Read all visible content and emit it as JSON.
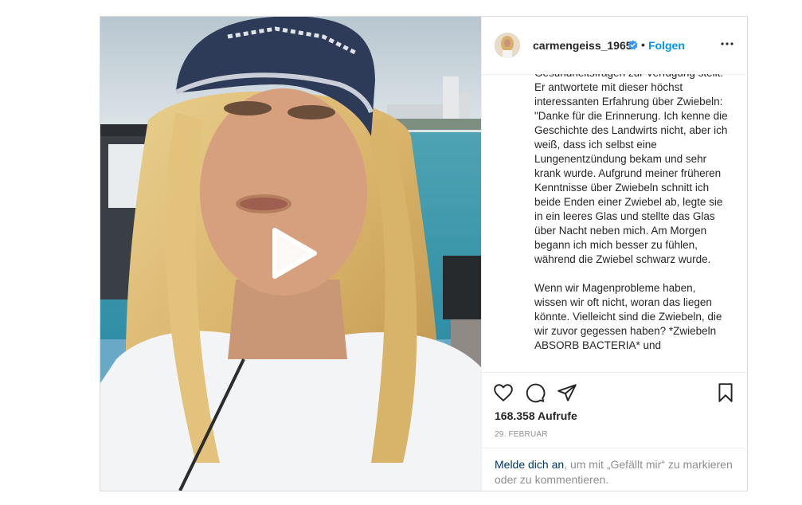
{
  "header": {
    "username": "carmengeiss_1965",
    "separator": "•",
    "follow_label": "Folgen",
    "icons": {
      "verified": "verified-badge-icon",
      "more": "more-options-icon"
    }
  },
  "media": {
    "type": "video",
    "play_icon": "play-icon"
  },
  "caption": {
    "text": "Gesundheitsfragen zur Verfügung stellt. Er antwortete mit dieser höchst interessanten Erfahrung über Zwiebeln: \"Danke für die Erinnerung. Ich kenne die Geschichte des Landwirts nicht, aber ich weiß, dass ich selbst eine Lungenentzündung bekam und sehr krank wurde. Aufgrund meiner früheren Kenntnisse über Zwiebeln schnitt ich beide Enden einer Zwiebel ab, legte sie in ein leeres Glas und stellte das Glas über Nacht neben mich. Am Morgen begann ich mich besser zu fühlen, während die Zwiebel schwarz wurde.\n\nWenn wir Magenprobleme haben, wissen wir oft nicht, woran das liegen könnte. Vielleicht sind die Zwiebeln, die wir zuvor gegessen haben? *Zwiebeln ABSORB BACTERIA* und"
  },
  "actions": {
    "icons": [
      "heart-icon",
      "comment-icon",
      "share-icon",
      "bookmark-icon"
    ]
  },
  "stats": {
    "views": "168.358 Aufrufe",
    "date": "29. Februar"
  },
  "login_prompt": {
    "link": "Melde dich an",
    "rest": ", um mit „Gefällt mir“ zu markieren oder zu kommentieren."
  },
  "colors": {
    "accent": "#0095f6",
    "link_dark": "#00376b",
    "muted": "#8e8e8e",
    "border": "#dbdbdb"
  }
}
